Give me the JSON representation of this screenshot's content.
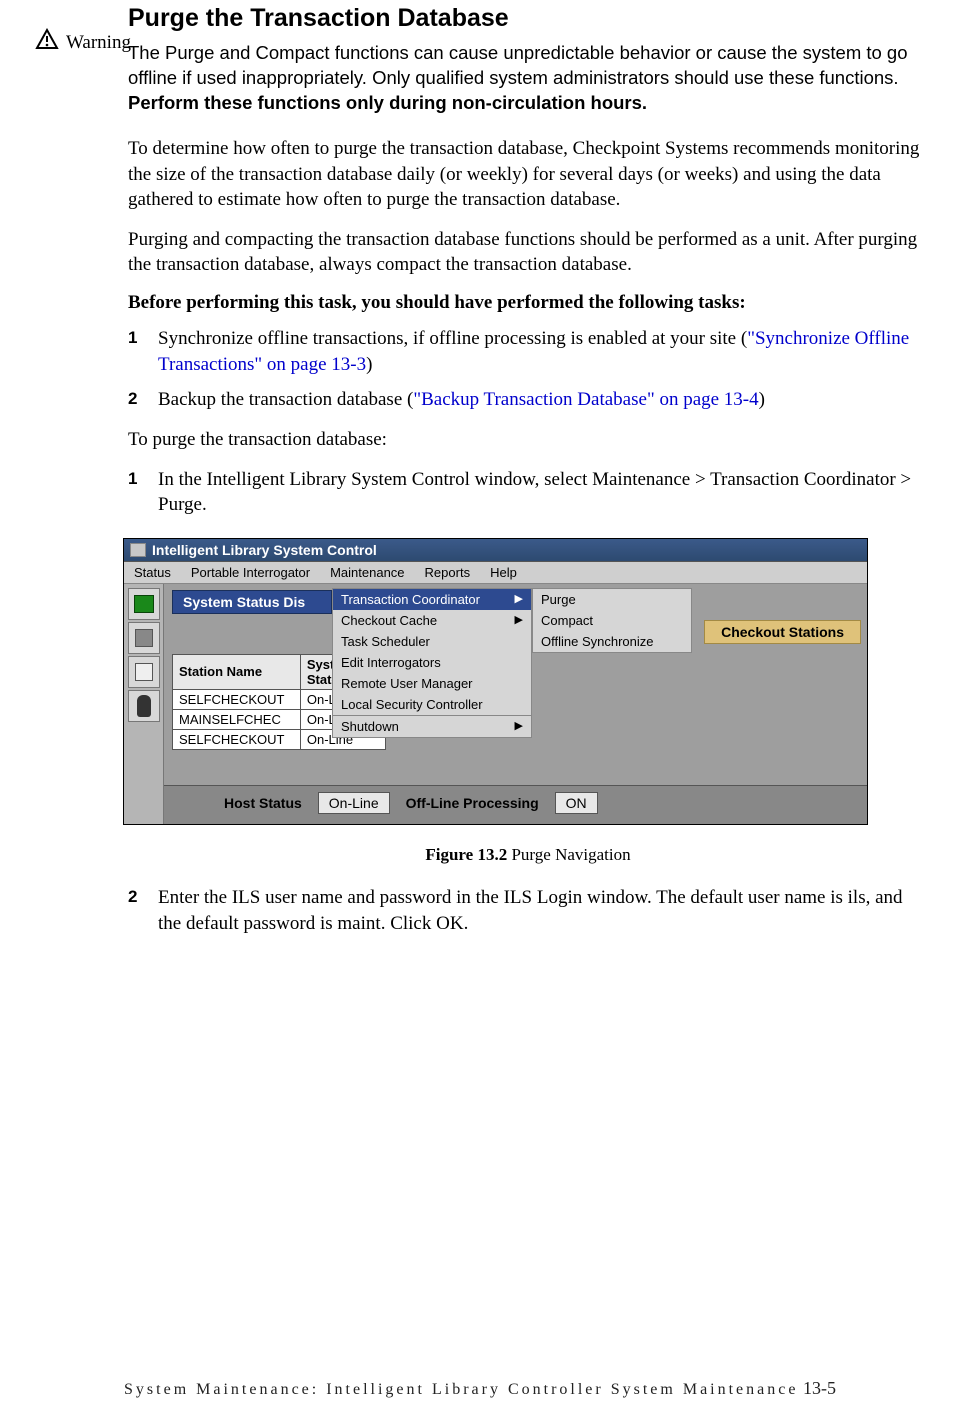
{
  "heading": "Purge the Transaction Database",
  "warning_label": "Warning",
  "warning_text_a": "The Purge and Compact functions can cause unpredictable behavior or cause the system to go offline if used inappropriately. Only qualified system administrators should use these functions. ",
  "warning_text_b": "Perform these functions only during non-circulation hours.",
  "para1": "To determine how often to purge the transaction database, Checkpoint Systems recommends monitoring the size of the transaction database daily (or weekly) for several days (or weeks) and using the data gathered to estimate how often to purge the transaction database.",
  "para2": "Purging and compacting the transaction database functions should be performed as a unit. After purging the transaction database, always compact the transaction database.",
  "prereq_heading": "Before performing this task, you should have performed the following tasks:",
  "prereq_list": {
    "item1_num": "1",
    "item1_text_a": "Synchronize offline transactions, if offline processing is enabled at your site (",
    "item1_link": "\"Synchronize Offline Transactions\" on page 13-3",
    "item1_text_b": ")",
    "item2_num": "2",
    "item2_text_a": "Backup the transaction database (",
    "item2_link": "\"Backup Transaction Database\" on page 13-4",
    "item2_text_b": ")"
  },
  "para3": "To purge the transaction database:",
  "steps": {
    "s1_num": "1",
    "s1_text_a": "In the Intelligent Library System Control window, select ",
    "s1_text_b": "Maintenance > Transaction Coordinator > Purge",
    "s1_text_c": ".",
    "s2_num": "2",
    "s2_text_a": "Enter the ILS user name and password in the ILS Login window. The default user name is ",
    "s2_text_b": "ils",
    "s2_text_c": ", and the default password is ",
    "s2_text_d": "maint",
    "s2_text_e": ". Click ",
    "s2_text_f": "OK",
    "s2_text_g": "."
  },
  "screenshot": {
    "title": "Intelligent Library System Control",
    "menubar": [
      "Status",
      "Portable Interrogator",
      "Maintenance",
      "Reports",
      "Help"
    ],
    "status_dis": "System Status Dis",
    "maint_menu": {
      "items": [
        {
          "label": "Transaction Coordinator",
          "arrow": "▶",
          "hi": true
        },
        {
          "label": "Checkout Cache",
          "arrow": "▶"
        },
        {
          "label": "Task Scheduler"
        },
        {
          "label": "Edit Interrogators"
        },
        {
          "label": "Remote User Manager"
        },
        {
          "label": "Local Security Controller"
        },
        {
          "label": "Shutdown",
          "arrow": "▶",
          "sep": true
        }
      ]
    },
    "sub_menu": [
      "Purge",
      "Compact",
      "Offline Synchronize"
    ],
    "checkout_hdr": "Checkout Stations",
    "table": {
      "headers": [
        "Station Name",
        "System State"
      ],
      "rows": [
        [
          "SELFCHECKOUT",
          "On-Line"
        ],
        [
          "MAINSELFCHEC",
          "On-Line"
        ],
        [
          "SELFCHECKOUT",
          "On-Line"
        ]
      ]
    },
    "host_status_label": "Host Status",
    "host_status_value": "On-Line",
    "offline_label": "Off-Line Processing",
    "offline_value": "ON"
  },
  "figure_caption_bold": "Figure 13.2",
  "figure_caption_plain": " Purge Navigation",
  "footer_text": "System Maintenance: Intelligent Library Controller System Maintenance",
  "footer_page": " 13-5"
}
